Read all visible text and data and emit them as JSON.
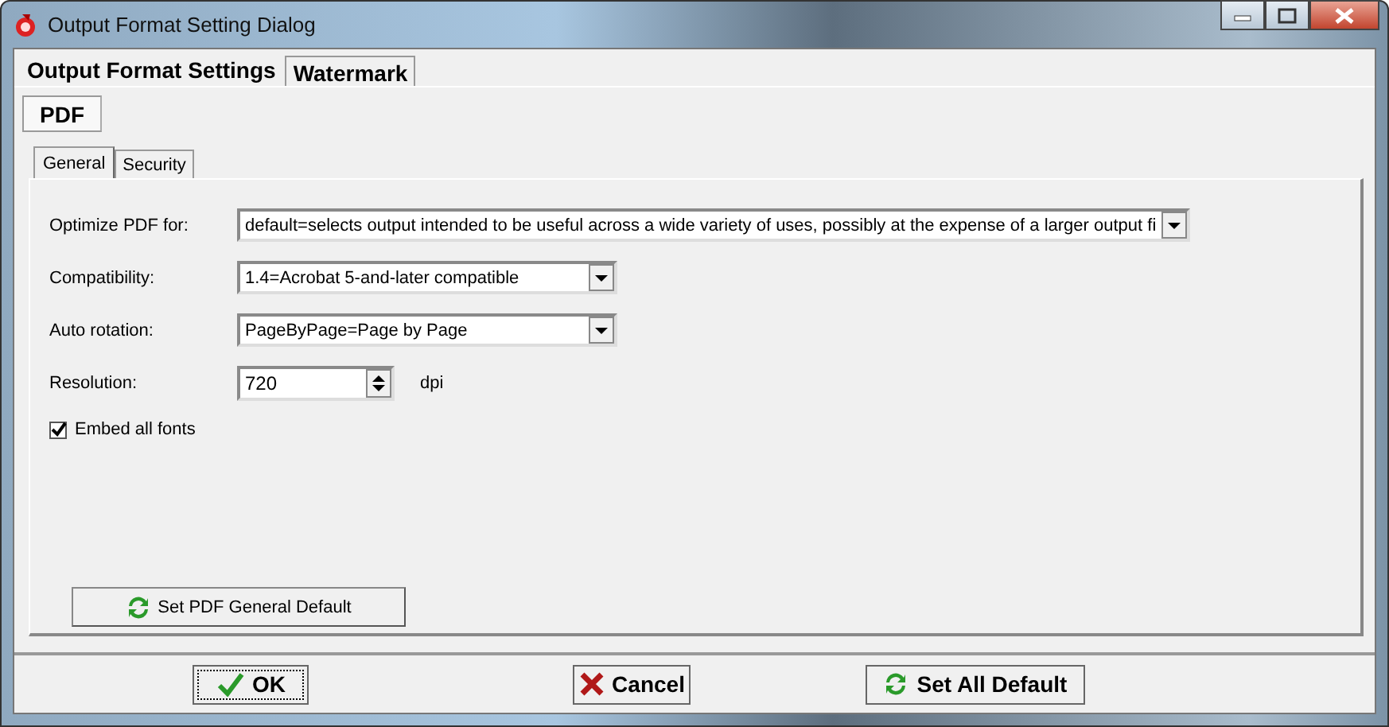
{
  "window": {
    "title": "Output Format Setting Dialog"
  },
  "main_tabs": [
    {
      "label": "Output Format Settings",
      "selected": true
    },
    {
      "label": "Watermark",
      "selected": false
    }
  ],
  "format_tabs": [
    {
      "label": "PDF",
      "selected": true
    }
  ],
  "sub_tabs": [
    {
      "label": "General",
      "selected": true
    },
    {
      "label": "Security",
      "selected": false
    }
  ],
  "fields": [
    {
      "kind": "combo",
      "label": "Optimize PDF for:",
      "value": "default=selects output intended to be useful across a wide variety of uses, possibly at the expense of a larger output fi"
    },
    {
      "kind": "combo",
      "label": "Compatibility:",
      "value": "1.4=Acrobat 5-and-later compatible"
    },
    {
      "kind": "combo",
      "label": "Auto rotation:",
      "value": "PageByPage=Page by Page"
    },
    {
      "kind": "spin",
      "label": "Resolution:",
      "value": "720",
      "unit": "dpi"
    }
  ],
  "options": [
    {
      "label": "Embed all fonts",
      "checked": true
    }
  ],
  "panel_button": {
    "label": "Set PDF General Default"
  },
  "buttons": [
    {
      "kind": "ok",
      "label": "OK"
    },
    {
      "kind": "cancel",
      "label": "Cancel"
    },
    {
      "kind": "reset",
      "label": "Set All Default"
    }
  ]
}
